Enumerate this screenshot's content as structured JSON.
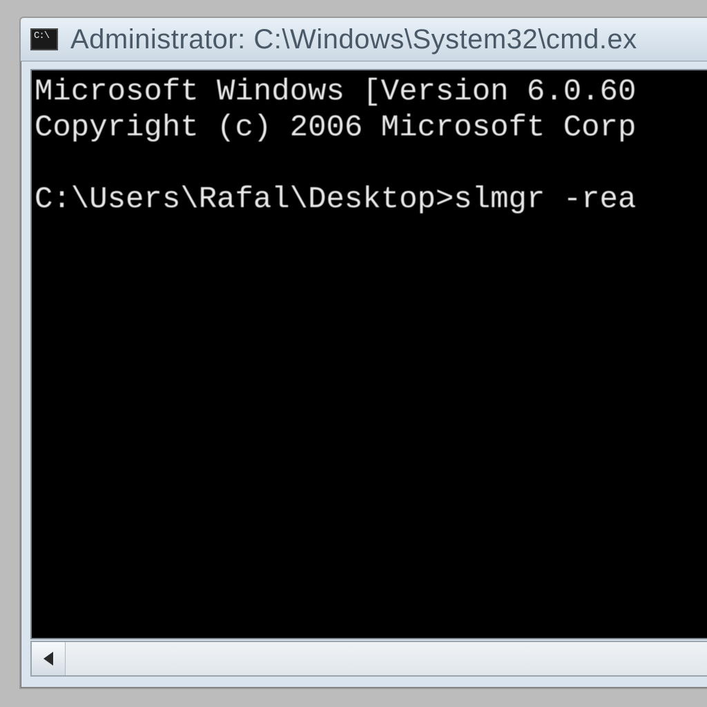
{
  "window": {
    "title": "Administrator: C:\\Windows\\System32\\cmd.ex",
    "icon": "cmd-icon"
  },
  "terminal": {
    "line1": "Microsoft Windows [Version 6.0.60",
    "line2": "Copyright (c) 2006 Microsoft Corp",
    "blank": "",
    "prompt": "C:\\Users\\Rafal\\Desktop>slmgr -rea"
  },
  "scrollbar": {
    "left_arrow": "scroll-left"
  }
}
